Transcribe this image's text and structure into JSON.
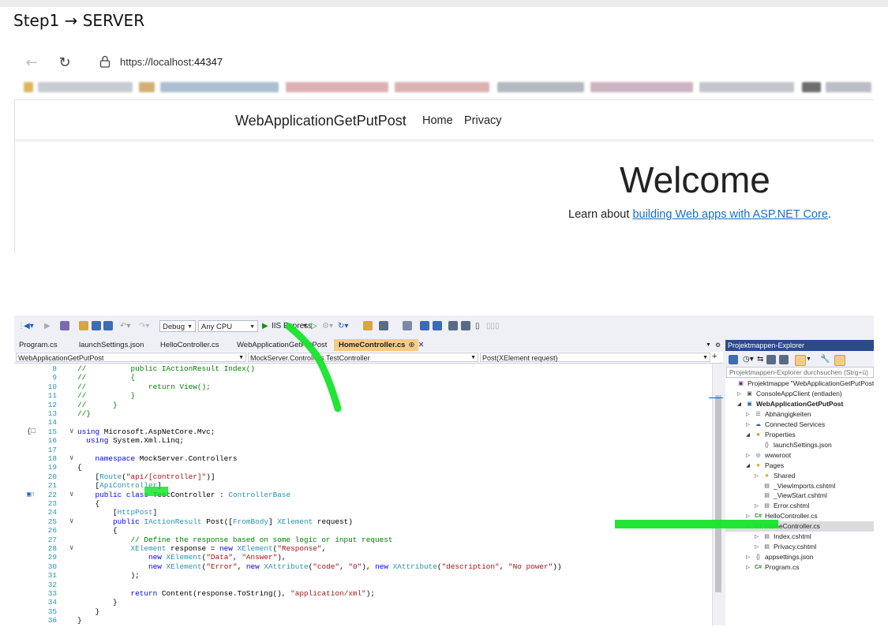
{
  "step_title": "Step1 → SERVER",
  "browser": {
    "url_host": "https://localhost",
    "url_port": ":44347",
    "brand": "WebApplicationGetPutPost",
    "nav_links": [
      "Home",
      "Privacy"
    ],
    "welcome": "Welcome",
    "learn_prefix": "Learn about ",
    "learn_link": "building Web apps with ASP.NET Core",
    "learn_suffix": "."
  },
  "vs": {
    "toolbar": {
      "config": "Debug",
      "platform": "Any CPU",
      "run_label": "IIS Express"
    },
    "tabs": [
      {
        "label": "Program.cs",
        "active": false
      },
      {
        "label": "launchSettings.json",
        "active": false
      },
      {
        "label": "HelloController.cs",
        "active": false
      },
      {
        "label": "WebApplicationGetPutPost",
        "active": false
      },
      {
        "label": "HomeController.cs",
        "active": true
      }
    ],
    "nav": {
      "project": "WebApplicationGetPutPost",
      "class": "MockServer.Controllers.TestController",
      "member": "Post(XElement request)"
    },
    "code_lines": [
      {
        "n": "8",
        "t": "        //          public IActionResult Index()"
      },
      {
        "n": "9",
        "t": "        //          {"
      },
      {
        "n": "10",
        "t": "        //              return View();"
      },
      {
        "n": "11",
        "t": "        //          }"
      },
      {
        "n": "12",
        "t": "        //      }"
      },
      {
        "n": "13",
        "t": "        //}"
      },
      {
        "n": "14",
        "t": ""
      },
      {
        "n": "15",
        "t": "        using Microsoft.AspNetCore.Mvc;"
      },
      {
        "n": "16",
        "t": "          using System.Xml.Linq;"
      },
      {
        "n": "17",
        "t": ""
      },
      {
        "n": "18",
        "t": "            namespace MockServer.Controllers"
      },
      {
        "n": "19",
        "t": "        {"
      },
      {
        "n": "20",
        "t": "            [Route(\"api/[controller]\")]"
      },
      {
        "n": "21",
        "t": "            [ApiController]"
      },
      {
        "n": "22",
        "t": "            public class TestController : ControllerBase"
      },
      {
        "n": "23",
        "t": "            {"
      },
      {
        "n": "24",
        "t": "                [HttpPost]"
      },
      {
        "n": "25",
        "t": "                public IActionResult Post([FromBody] XElement request)"
      },
      {
        "n": "26",
        "t": "                {"
      },
      {
        "n": "27",
        "t": "                    // Define the response based on some logic or input request"
      },
      {
        "n": "28",
        "t": "                    XElement response = new XElement(\"Response\","
      },
      {
        "n": "29",
        "t": "                        new XElement(\"Data\", \"Answer\"),"
      },
      {
        "n": "30",
        "t": "                        new XElement(\"Error\", new XAttribute(\"code\", \"0\"), new XAttribute(\"description\", \"No power\"))"
      },
      {
        "n": "31",
        "t": "                    );"
      },
      {
        "n": "32",
        "t": ""
      },
      {
        "n": "33",
        "t": "                    return Content(response.ToString(), \"application/xml\");"
      },
      {
        "n": "34",
        "t": "                }"
      },
      {
        "n": "35",
        "t": "            }"
      },
      {
        "n": "36",
        "t": "        }"
      }
    ],
    "solution_explorer": {
      "title": "Projektmappen-Explorer",
      "search_placeholder": "Projektmappen-Explorer durchsuchen (Strg+ü)",
      "nodes": [
        {
          "label": "Projektmappe \"WebApplicationGetPutPost\" (1",
          "level": 0,
          "icon": "solution-icon",
          "exp": ""
        },
        {
          "label": "ConsoleAppClient (entladen)",
          "level": 1,
          "icon": "project-icon",
          "exp": "▷"
        },
        {
          "label": "WebApplicationGetPutPost",
          "level": 1,
          "icon": "web-project-icon",
          "exp": "◢",
          "bold": true
        },
        {
          "label": "Abhängigkeiten",
          "level": 2,
          "icon": "dependencies-icon",
          "exp": "▷"
        },
        {
          "label": "Connected Services",
          "level": 2,
          "icon": "connected-services-icon",
          "exp": "▷"
        },
        {
          "label": "Properties",
          "level": 2,
          "icon": "properties-icon",
          "exp": "◢"
        },
        {
          "label": "launchSettings.json",
          "level": 3,
          "icon": "json-file-icon",
          "exp": ""
        },
        {
          "label": "wwwroot",
          "level": 2,
          "icon": "globe-icon",
          "exp": "▷"
        },
        {
          "label": "Pages",
          "level": 2,
          "icon": "folder-icon",
          "exp": "◢"
        },
        {
          "label": "Shared",
          "level": 3,
          "icon": "folder-icon",
          "exp": "▷"
        },
        {
          "label": "_ViewImports.cshtml",
          "level": 3,
          "icon": "cshtml-file-icon",
          "exp": ""
        },
        {
          "label": "_ViewStart.cshtml",
          "level": 3,
          "icon": "cshtml-file-icon",
          "exp": ""
        },
        {
          "label": "Error.cshtml",
          "level": 3,
          "icon": "cshtml-file-icon",
          "exp": "▷"
        },
        {
          "label": "HelloController.cs",
          "level": 2,
          "icon": "csharp-file-icon",
          "exp": "▷"
        },
        {
          "label": "HomeController.cs",
          "level": 2,
          "icon": "csharp-file-icon",
          "exp": "▷",
          "selected": true
        },
        {
          "label": "Index.cshtml",
          "level": 3,
          "icon": "cshtml-file-icon",
          "exp": "▷"
        },
        {
          "label": "Privacy.cshtml",
          "level": 3,
          "icon": "cshtml-file-icon",
          "exp": "▷"
        },
        {
          "label": "appsettings.json",
          "level": 2,
          "icon": "json-file-icon",
          "exp": "▷"
        },
        {
          "label": "Program.cs",
          "level": 2,
          "icon": "csharp-file-icon",
          "exp": "▷"
        }
      ]
    }
  },
  "colors": {
    "highlight": "#16e42a",
    "link": "#1b6ec2",
    "keyword": "#0000ff",
    "type": "#2b91af",
    "string": "#a31515",
    "comment": "#008000",
    "active_tab": "#f5cc84"
  }
}
